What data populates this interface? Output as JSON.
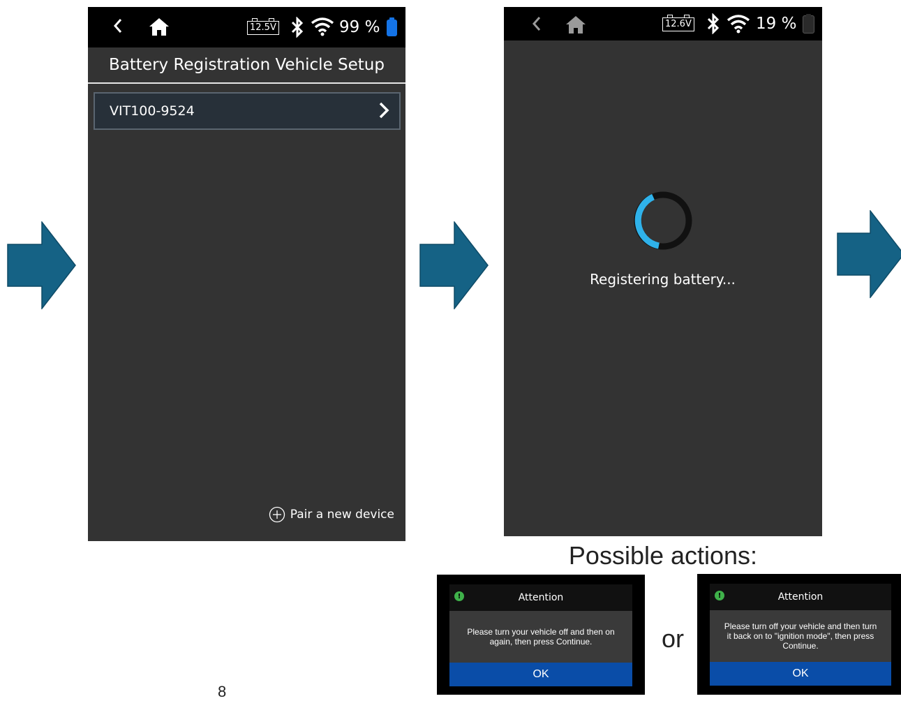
{
  "screen1": {
    "status": {
      "voltage": "12.5V",
      "battery_pct": "99 %",
      "battery_color": "#1473e6"
    },
    "title": "Battery Registration Vehicle Setup",
    "device_item": "VIT100-9524",
    "pair_label": "Pair a new device"
  },
  "screen2": {
    "status": {
      "voltage": "12.6V",
      "battery_pct": "19 %",
      "battery_color": "#2a2a2a"
    },
    "message": "Registering battery..."
  },
  "caption": "Possible actions:",
  "separator": "or",
  "dialogs": [
    {
      "title": "Attention",
      "body": "Please turn your vehicle off and then on again, then press Continue.",
      "ok_label": "OK"
    },
    {
      "title": "Attention",
      "body": "Please turn off your vehicle and then turn it back on to \"ignition mode\", then press Continue.",
      "ok_label": "OK"
    }
  ],
  "page_number": "8",
  "colors": {
    "arrow": "#156285",
    "spinner_accent": "#2fb2ea",
    "ok_button": "#0a4da8"
  }
}
